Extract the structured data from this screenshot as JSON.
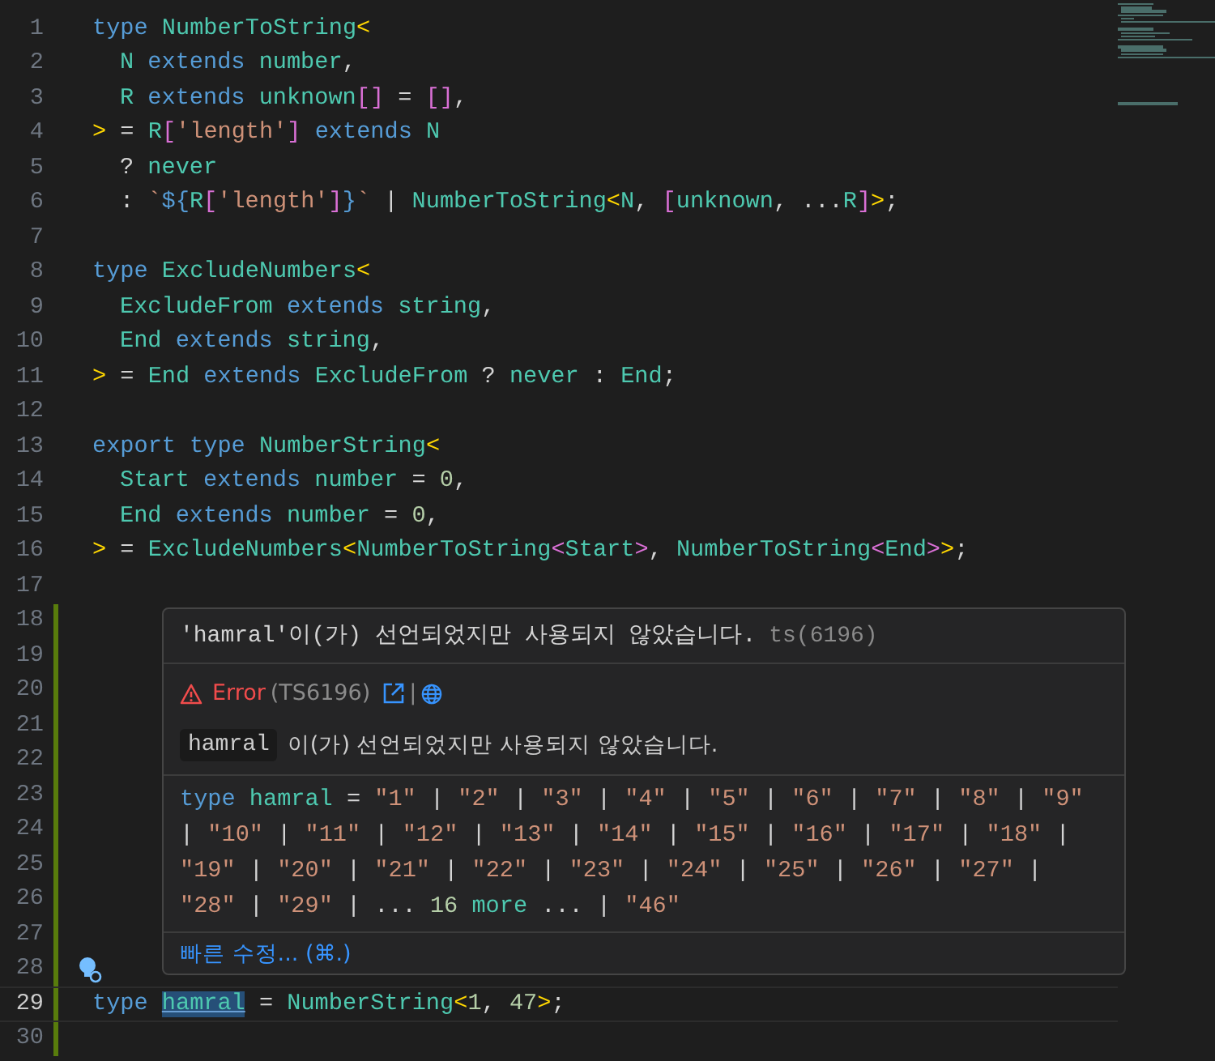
{
  "editor": {
    "lines": [
      {
        "number": "1",
        "modified": false,
        "tokens": [
          {
            "kind": "keyword",
            "text": "type "
          },
          {
            "kind": "type",
            "text": "NumberToString"
          },
          {
            "kind": "bracket",
            "text": "<"
          }
        ]
      },
      {
        "number": "2",
        "modified": false,
        "indented": true,
        "tokens": [
          {
            "kind": "type",
            "text": "N"
          },
          {
            "kind": "keyword",
            "text": " extends "
          },
          {
            "kind": "type",
            "text": "number"
          },
          {
            "kind": "plain",
            "text": ","
          }
        ]
      },
      {
        "number": "3",
        "modified": false,
        "indented": true,
        "tokens": [
          {
            "kind": "type",
            "text": "R"
          },
          {
            "kind": "keyword",
            "text": " extends "
          },
          {
            "kind": "type",
            "text": "unknown"
          },
          {
            "kind": "bracket2",
            "text": "[]"
          },
          {
            "kind": "plain",
            "text": " = "
          },
          {
            "kind": "bracket2",
            "text": "[]"
          },
          {
            "kind": "plain",
            "text": ","
          }
        ]
      },
      {
        "number": "4",
        "modified": false,
        "tokens": [
          {
            "kind": "bracket",
            "text": ">"
          },
          {
            "kind": "plain",
            "text": " = "
          },
          {
            "kind": "type",
            "text": "R"
          },
          {
            "kind": "bracket2",
            "text": "["
          },
          {
            "kind": "string",
            "text": "'length'"
          },
          {
            "kind": "bracket2",
            "text": "]"
          },
          {
            "kind": "keyword",
            "text": " extends "
          },
          {
            "kind": "type",
            "text": "N"
          }
        ]
      },
      {
        "number": "5",
        "modified": false,
        "indented": true,
        "tokens": [
          {
            "kind": "plain",
            "text": "? "
          },
          {
            "kind": "type",
            "text": "never"
          }
        ]
      },
      {
        "number": "6",
        "modified": false,
        "indented": true,
        "tokens": [
          {
            "kind": "plain",
            "text": ": "
          },
          {
            "kind": "string",
            "text": "`"
          },
          {
            "kind": "keyword",
            "text": "${"
          },
          {
            "kind": "type",
            "text": "R"
          },
          {
            "kind": "bracket2",
            "text": "["
          },
          {
            "kind": "string",
            "text": "'length'"
          },
          {
            "kind": "bracket2",
            "text": "]"
          },
          {
            "kind": "keyword",
            "text": "}"
          },
          {
            "kind": "string",
            "text": "`"
          },
          {
            "kind": "plain",
            "text": " | "
          },
          {
            "kind": "type",
            "text": "NumberToString"
          },
          {
            "kind": "bracket",
            "text": "<"
          },
          {
            "kind": "type",
            "text": "N"
          },
          {
            "kind": "plain",
            "text": ", "
          },
          {
            "kind": "bracket2",
            "text": "["
          },
          {
            "kind": "type",
            "text": "unknown"
          },
          {
            "kind": "plain",
            "text": ", ..."
          },
          {
            "kind": "type",
            "text": "R"
          },
          {
            "kind": "bracket2",
            "text": "]"
          },
          {
            "kind": "bracket",
            "text": ">"
          },
          {
            "kind": "plain",
            "text": ";"
          }
        ]
      },
      {
        "number": "7",
        "modified": false
      },
      {
        "number": "8",
        "modified": false,
        "tokens": [
          {
            "kind": "keyword",
            "text": "type "
          },
          {
            "kind": "type",
            "text": "ExcludeNumbers"
          },
          {
            "kind": "bracket",
            "text": "<"
          }
        ]
      },
      {
        "number": "9",
        "modified": false,
        "indented": true,
        "tokens": [
          {
            "kind": "type",
            "text": "ExcludeFrom"
          },
          {
            "kind": "keyword",
            "text": " extends "
          },
          {
            "kind": "type",
            "text": "string"
          },
          {
            "kind": "plain",
            "text": ","
          }
        ]
      },
      {
        "number": "10",
        "modified": false,
        "indented": true,
        "tokens": [
          {
            "kind": "type",
            "text": "End"
          },
          {
            "kind": "keyword",
            "text": " extends "
          },
          {
            "kind": "type",
            "text": "string"
          },
          {
            "kind": "plain",
            "text": ","
          }
        ]
      },
      {
        "number": "11",
        "modified": false,
        "tokens": [
          {
            "kind": "bracket",
            "text": ">"
          },
          {
            "kind": "plain",
            "text": " = "
          },
          {
            "kind": "type",
            "text": "End"
          },
          {
            "kind": "keyword",
            "text": " extends "
          },
          {
            "kind": "type",
            "text": "ExcludeFrom"
          },
          {
            "kind": "plain",
            "text": " ? "
          },
          {
            "kind": "type",
            "text": "never"
          },
          {
            "kind": "plain",
            "text": " : "
          },
          {
            "kind": "type",
            "text": "End"
          },
          {
            "kind": "plain",
            "text": ";"
          }
        ]
      },
      {
        "number": "12",
        "modified": false
      },
      {
        "number": "13",
        "modified": false,
        "tokens": [
          {
            "kind": "keyword",
            "text": "export type "
          },
          {
            "kind": "type",
            "text": "NumberString"
          },
          {
            "kind": "bracket",
            "text": "<"
          }
        ]
      },
      {
        "number": "14",
        "modified": false,
        "indented": true,
        "tokens": [
          {
            "kind": "type",
            "text": "Start"
          },
          {
            "kind": "keyword",
            "text": " extends "
          },
          {
            "kind": "type",
            "text": "number"
          },
          {
            "kind": "plain",
            "text": " = "
          },
          {
            "kind": "number",
            "text": "0"
          },
          {
            "kind": "plain",
            "text": ","
          }
        ]
      },
      {
        "number": "15",
        "modified": false,
        "indented": true,
        "tokens": [
          {
            "kind": "type",
            "text": "End"
          },
          {
            "kind": "keyword",
            "text": " extends "
          },
          {
            "kind": "type",
            "text": "number"
          },
          {
            "kind": "plain",
            "text": " = "
          },
          {
            "kind": "number",
            "text": "0"
          },
          {
            "kind": "plain",
            "text": ","
          }
        ]
      },
      {
        "number": "16",
        "modified": false,
        "tokens": [
          {
            "kind": "bracket",
            "text": ">"
          },
          {
            "kind": "plain",
            "text": " = "
          },
          {
            "kind": "type",
            "text": "ExcludeNumbers"
          },
          {
            "kind": "bracket",
            "text": "<"
          },
          {
            "kind": "type",
            "text": "NumberToString"
          },
          {
            "kind": "bracket2",
            "text": "<"
          },
          {
            "kind": "type",
            "text": "Start"
          },
          {
            "kind": "bracket2",
            "text": ">"
          },
          {
            "kind": "plain",
            "text": ", "
          },
          {
            "kind": "type",
            "text": "NumberToString"
          },
          {
            "kind": "bracket2",
            "text": "<"
          },
          {
            "kind": "type",
            "text": "End"
          },
          {
            "kind": "bracket2",
            "text": ">"
          },
          {
            "kind": "bracket",
            "text": ">"
          },
          {
            "kind": "plain",
            "text": ";"
          }
        ]
      },
      {
        "number": "17",
        "modified": false
      },
      {
        "number": "18",
        "modified": true
      },
      {
        "number": "19",
        "modified": true
      },
      {
        "number": "20",
        "modified": true
      },
      {
        "number": "21",
        "modified": true
      },
      {
        "number": "22",
        "modified": true
      },
      {
        "number": "23",
        "modified": true
      },
      {
        "number": "24",
        "modified": true
      },
      {
        "number": "25",
        "modified": true
      },
      {
        "number": "26",
        "modified": true
      },
      {
        "number": "27",
        "modified": true
      },
      {
        "number": "28",
        "modified": true,
        "lightbulb": true
      },
      {
        "number": "29",
        "modified": true,
        "current": true,
        "tokens": [
          {
            "kind": "keyword",
            "text": "type "
          },
          {
            "kind": "selected",
            "text": "hamral"
          },
          {
            "kind": "plain",
            "text": " = "
          },
          {
            "kind": "type",
            "text": "NumberString"
          },
          {
            "kind": "bracket",
            "text": "<"
          },
          {
            "kind": "number",
            "text": "1"
          },
          {
            "kind": "plain",
            "text": ", "
          },
          {
            "kind": "number",
            "text": "47"
          },
          {
            "kind": "bracket",
            "text": ">"
          },
          {
            "kind": "plain",
            "text": ";"
          }
        ]
      },
      {
        "number": "30",
        "modified": true
      }
    ]
  },
  "hover": {
    "message": "'hamral'이(가) 선언되었지만 사용되지 않았습니다.",
    "source": "ts(6196)",
    "kind": "error",
    "severity_label": "Error",
    "code": "(TS6196)",
    "separator": "|",
    "detail_code": "hamral",
    "detail_text": "이(가) 선언되었지만 사용되지 않았습니다.",
    "type_lines": [
      [
        {
          "kind": "keyword",
          "text": "type "
        },
        {
          "kind": "type",
          "text": "hamral"
        },
        {
          "kind": "plain",
          "text": " = "
        },
        {
          "kind": "string",
          "text": "\"1\""
        },
        {
          "kind": "plain",
          "text": " | "
        },
        {
          "kind": "string",
          "text": "\"2\""
        },
        {
          "kind": "plain",
          "text": " | "
        },
        {
          "kind": "string",
          "text": "\"3\""
        },
        {
          "kind": "plain",
          "text": " | "
        },
        {
          "kind": "string",
          "text": "\"4\""
        },
        {
          "kind": "plain",
          "text": " | "
        },
        {
          "kind": "string",
          "text": "\"5\""
        },
        {
          "kind": "plain",
          "text": " | "
        },
        {
          "kind": "string",
          "text": "\"6\""
        },
        {
          "kind": "plain",
          "text": " | "
        },
        {
          "kind": "string",
          "text": "\"7\""
        },
        {
          "kind": "plain",
          "text": " | "
        },
        {
          "kind": "string",
          "text": "\"8\""
        },
        {
          "kind": "plain",
          "text": " | "
        },
        {
          "kind": "string",
          "text": "\"9\""
        }
      ],
      [
        {
          "kind": "plain",
          "text": "| "
        },
        {
          "kind": "string",
          "text": "\"10\""
        },
        {
          "kind": "plain",
          "text": " | "
        },
        {
          "kind": "string",
          "text": "\"11\""
        },
        {
          "kind": "plain",
          "text": " | "
        },
        {
          "kind": "string",
          "text": "\"12\""
        },
        {
          "kind": "plain",
          "text": " | "
        },
        {
          "kind": "string",
          "text": "\"13\""
        },
        {
          "kind": "plain",
          "text": " | "
        },
        {
          "kind": "string",
          "text": "\"14\""
        },
        {
          "kind": "plain",
          "text": " | "
        },
        {
          "kind": "string",
          "text": "\"15\""
        },
        {
          "kind": "plain",
          "text": " | "
        },
        {
          "kind": "string",
          "text": "\"16\""
        },
        {
          "kind": "plain",
          "text": " | "
        },
        {
          "kind": "string",
          "text": "\"17\""
        },
        {
          "kind": "plain",
          "text": " | "
        },
        {
          "kind": "string",
          "text": "\"18\""
        },
        {
          "kind": "plain",
          "text": " |"
        }
      ],
      [
        {
          "kind": "string",
          "text": "\"19\""
        },
        {
          "kind": "plain",
          "text": " | "
        },
        {
          "kind": "string",
          "text": "\"20\""
        },
        {
          "kind": "plain",
          "text": " | "
        },
        {
          "kind": "string",
          "text": "\"21\""
        },
        {
          "kind": "plain",
          "text": " | "
        },
        {
          "kind": "string",
          "text": "\"22\""
        },
        {
          "kind": "plain",
          "text": " | "
        },
        {
          "kind": "string",
          "text": "\"23\""
        },
        {
          "kind": "plain",
          "text": " | "
        },
        {
          "kind": "string",
          "text": "\"24\""
        },
        {
          "kind": "plain",
          "text": " | "
        },
        {
          "kind": "string",
          "text": "\"25\""
        },
        {
          "kind": "plain",
          "text": " | "
        },
        {
          "kind": "string",
          "text": "\"26\""
        },
        {
          "kind": "plain",
          "text": " | "
        },
        {
          "kind": "string",
          "text": "\"27\""
        },
        {
          "kind": "plain",
          "text": " |"
        }
      ],
      [
        {
          "kind": "string",
          "text": "\"28\""
        },
        {
          "kind": "plain",
          "text": " | "
        },
        {
          "kind": "string",
          "text": "\"29\""
        },
        {
          "kind": "plain",
          "text": " | ... "
        },
        {
          "kind": "number",
          "text": "16"
        },
        {
          "kind": "type",
          "text": " more"
        },
        {
          "kind": "plain",
          "text": " ... | "
        },
        {
          "kind": "string",
          "text": "\"46\""
        }
      ]
    ],
    "quick_fix": "빠른 수정... (⌘.)"
  }
}
